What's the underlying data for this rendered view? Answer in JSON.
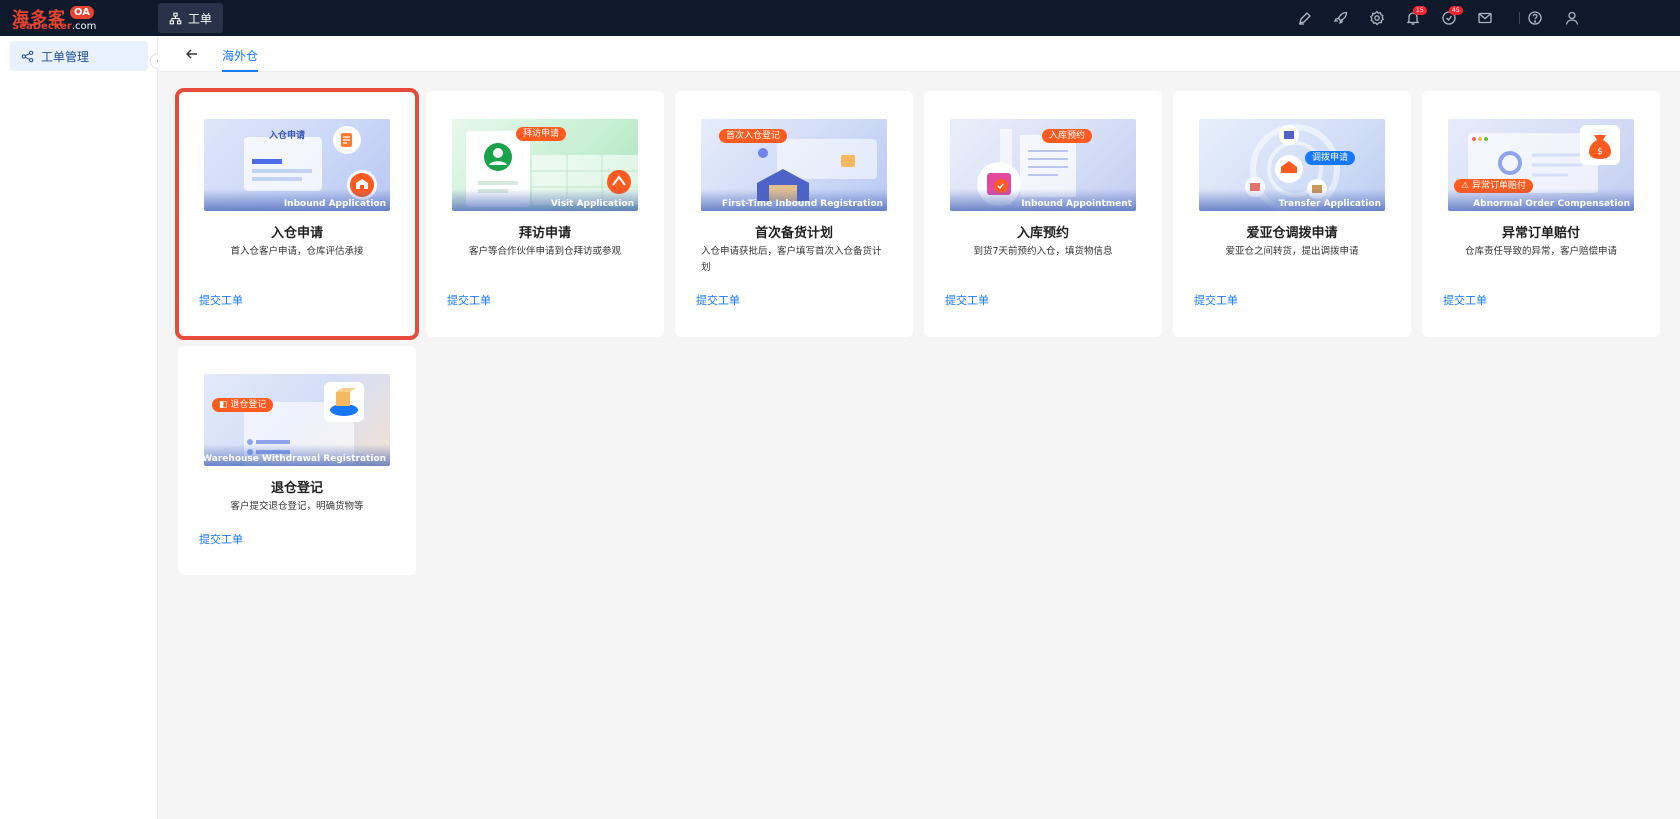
{
  "logo": {
    "cn": "海多客",
    "badge": "OA",
    "en_brand": "SeaDecker",
    "en_domain": ".com"
  },
  "topbar": {
    "tab_label": "工单",
    "notifications_badge": "15",
    "todo_badge": "45"
  },
  "sidebar": {
    "items": [
      {
        "label": "工单管理"
      }
    ]
  },
  "subheader": {
    "tab_label": "海外仓"
  },
  "cards": [
    {
      "banner_tag": "入仓申请",
      "banner_caption": "Inbound Application",
      "title": "入仓申请",
      "desc": "首入仓客户申请，仓库评估承接",
      "link": "提交工单"
    },
    {
      "banner_tag": "拜访申请",
      "banner_caption": "Visit Application",
      "title": "拜访申请",
      "desc": "客户等合作伙伴申请到仓拜访或参观",
      "link": "提交工单"
    },
    {
      "banner_tag": "首次入仓登记",
      "banner_caption": "First-Time Inbound Registration",
      "title": "首次备货计划",
      "desc": "入仓申请获批后，客户填写首次入仓备货计划",
      "link": "提交工单"
    },
    {
      "banner_tag": "入库预约",
      "banner_caption": "Inbound Appointment",
      "title": "入库预约",
      "desc": "到货7天前预约入仓，填货物信息",
      "link": "提交工单"
    },
    {
      "banner_tag": "调拨申请",
      "banner_caption": "Transfer Application",
      "title": "爱亚仓调拨申请",
      "desc": "爱亚仓之间转货，提出调拨申请",
      "link": "提交工单"
    },
    {
      "banner_tag": "异常订单赔付",
      "banner_caption": "Abnormal Order Compensation",
      "title": "异常订单赔付",
      "desc": "仓库责任导致的异常，客户赔偿申请",
      "link": "提交工单"
    },
    {
      "banner_tag": "退仓登记",
      "banner_caption": "Warehouse Withdrawal Registration",
      "title": "退仓登记",
      "desc": "客户提交退仓登记，明确货物等",
      "link": "提交工单"
    }
  ],
  "colors": {
    "accent": "#1677ff",
    "topbar": "#0e1a2b",
    "brand": "#e8432f",
    "selection": "#e84b3c"
  }
}
